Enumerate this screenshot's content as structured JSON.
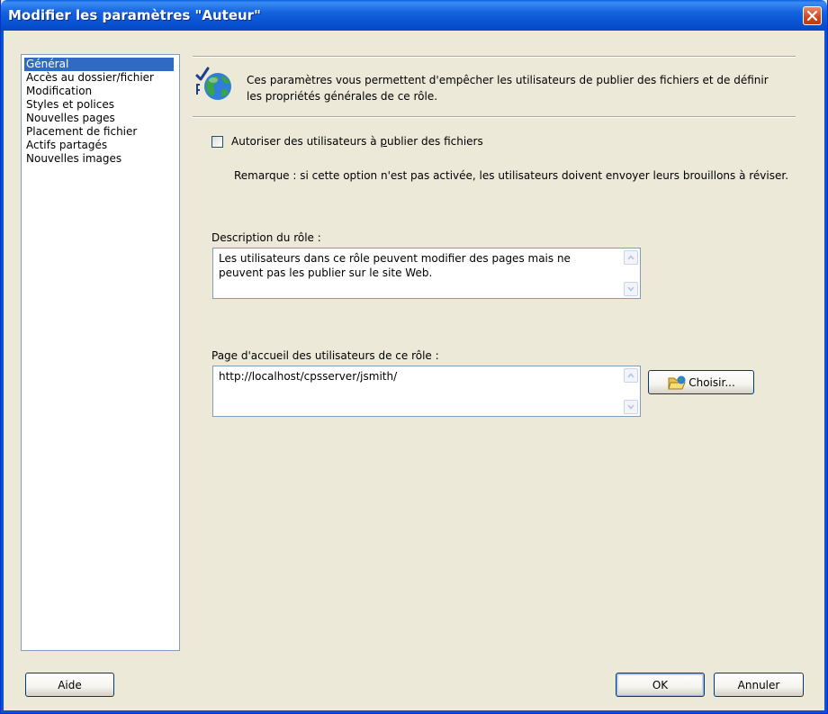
{
  "window": {
    "title": "Modifier les paramètres \"Auteur\""
  },
  "nav": {
    "items": [
      {
        "label": "Général",
        "selected": true
      },
      {
        "label": "Accès au dossier/fichier",
        "selected": false
      },
      {
        "label": "Modification",
        "selected": false
      },
      {
        "label": "Styles et polices",
        "selected": false
      },
      {
        "label": "Nouvelles pages",
        "selected": false
      },
      {
        "label": "Placement de fichier",
        "selected": false
      },
      {
        "label": "Actifs partagés",
        "selected": false
      },
      {
        "label": "Nouvelles images",
        "selected": false
      }
    ]
  },
  "general": {
    "info_icon": "globe-check-icon",
    "info_text": "Ces paramètres vous permettent d'empêcher les utilisateurs de publier des fichiers et de définir les propriétés générales de ce rôle.",
    "allow_publish": {
      "label_before": "Autoriser des utilisateurs à ",
      "label_accel": "p",
      "label_after": "ublier des fichiers",
      "checked": false
    },
    "note": "Remarque : si cette option n'est pas activée, les utilisateurs doivent envoyer leurs brouillons à réviser.",
    "role_description": {
      "label": "Description du rôle :",
      "value": "Les utilisateurs dans ce rôle peuvent modifier des pages mais ne peuvent pas les publier sur le site Web."
    },
    "home_page": {
      "label": "Page d'accueil des utilisateurs de ce rôle :",
      "value": "http://localhost/cpsserver/jsmith/",
      "browse_label": "Choisir...",
      "browse_icon": "folder-open-icon"
    }
  },
  "footer": {
    "help_label": "Aide",
    "ok_label": "OK",
    "cancel_label": "Annuler"
  },
  "colors": {
    "title_bar": "#0a55d4",
    "selection": "#316ac5",
    "dialog_bg": "#ece9d8"
  }
}
